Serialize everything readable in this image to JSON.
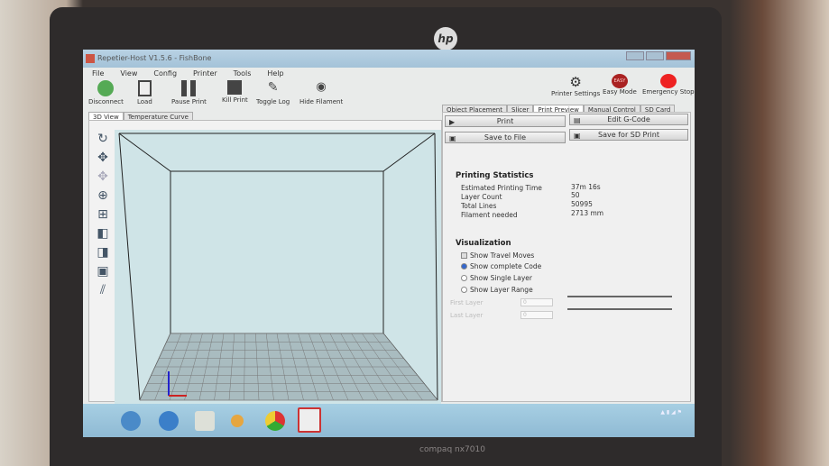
{
  "device": {
    "brand_logo": "hp",
    "model": "compaq nx7010"
  },
  "window": {
    "title": "Repetier-Host V1.5.6 - FishBone"
  },
  "menu": [
    "File",
    "View",
    "Config",
    "Printer",
    "Tools",
    "Help"
  ],
  "toolbar": {
    "disconnect": "Disconnect",
    "load": "Load",
    "pause": "Pause Print",
    "kill": "Kill Print",
    "toggle_log": "Toggle Log",
    "hide_filament": "Hide Filament",
    "printer_settings": "Printer Settings",
    "easy_mode": "Easy Mode",
    "easy_badge": "EASY",
    "emergency_stop": "Emergency Stop"
  },
  "left_tabs": [
    "3D View",
    "Temperature Curve"
  ],
  "right_tabs": [
    "Object Placement",
    "Slicer",
    "Print Preview",
    "Manual Control",
    "SD Card"
  ],
  "buttons": {
    "print": "Print",
    "edit_gcode": "Edit G-Code",
    "save_file": "Save to File",
    "save_sd": "Save for SD Print"
  },
  "stats": {
    "heading": "Printing Statistics",
    "rows": [
      {
        "label": "Estimated Printing Time",
        "value": "37m 16s"
      },
      {
        "label": "Layer Count",
        "value": "50"
      },
      {
        "label": "Total Lines",
        "value": "50995"
      },
      {
        "label": "Filament needed",
        "value": "2713 mm"
      }
    ]
  },
  "visualization": {
    "heading": "Visualization",
    "show_travel": "Show Travel Moves",
    "complete": "Show complete Code",
    "single": "Show Single Layer",
    "range": "Show Layer Range",
    "first_layer": "First Layer",
    "last_layer": "Last Layer",
    "first_value": "0",
    "last_value": "0"
  },
  "colors": {
    "view_bg": "#cfe4e7",
    "taskbar": "#9cc6dc"
  }
}
